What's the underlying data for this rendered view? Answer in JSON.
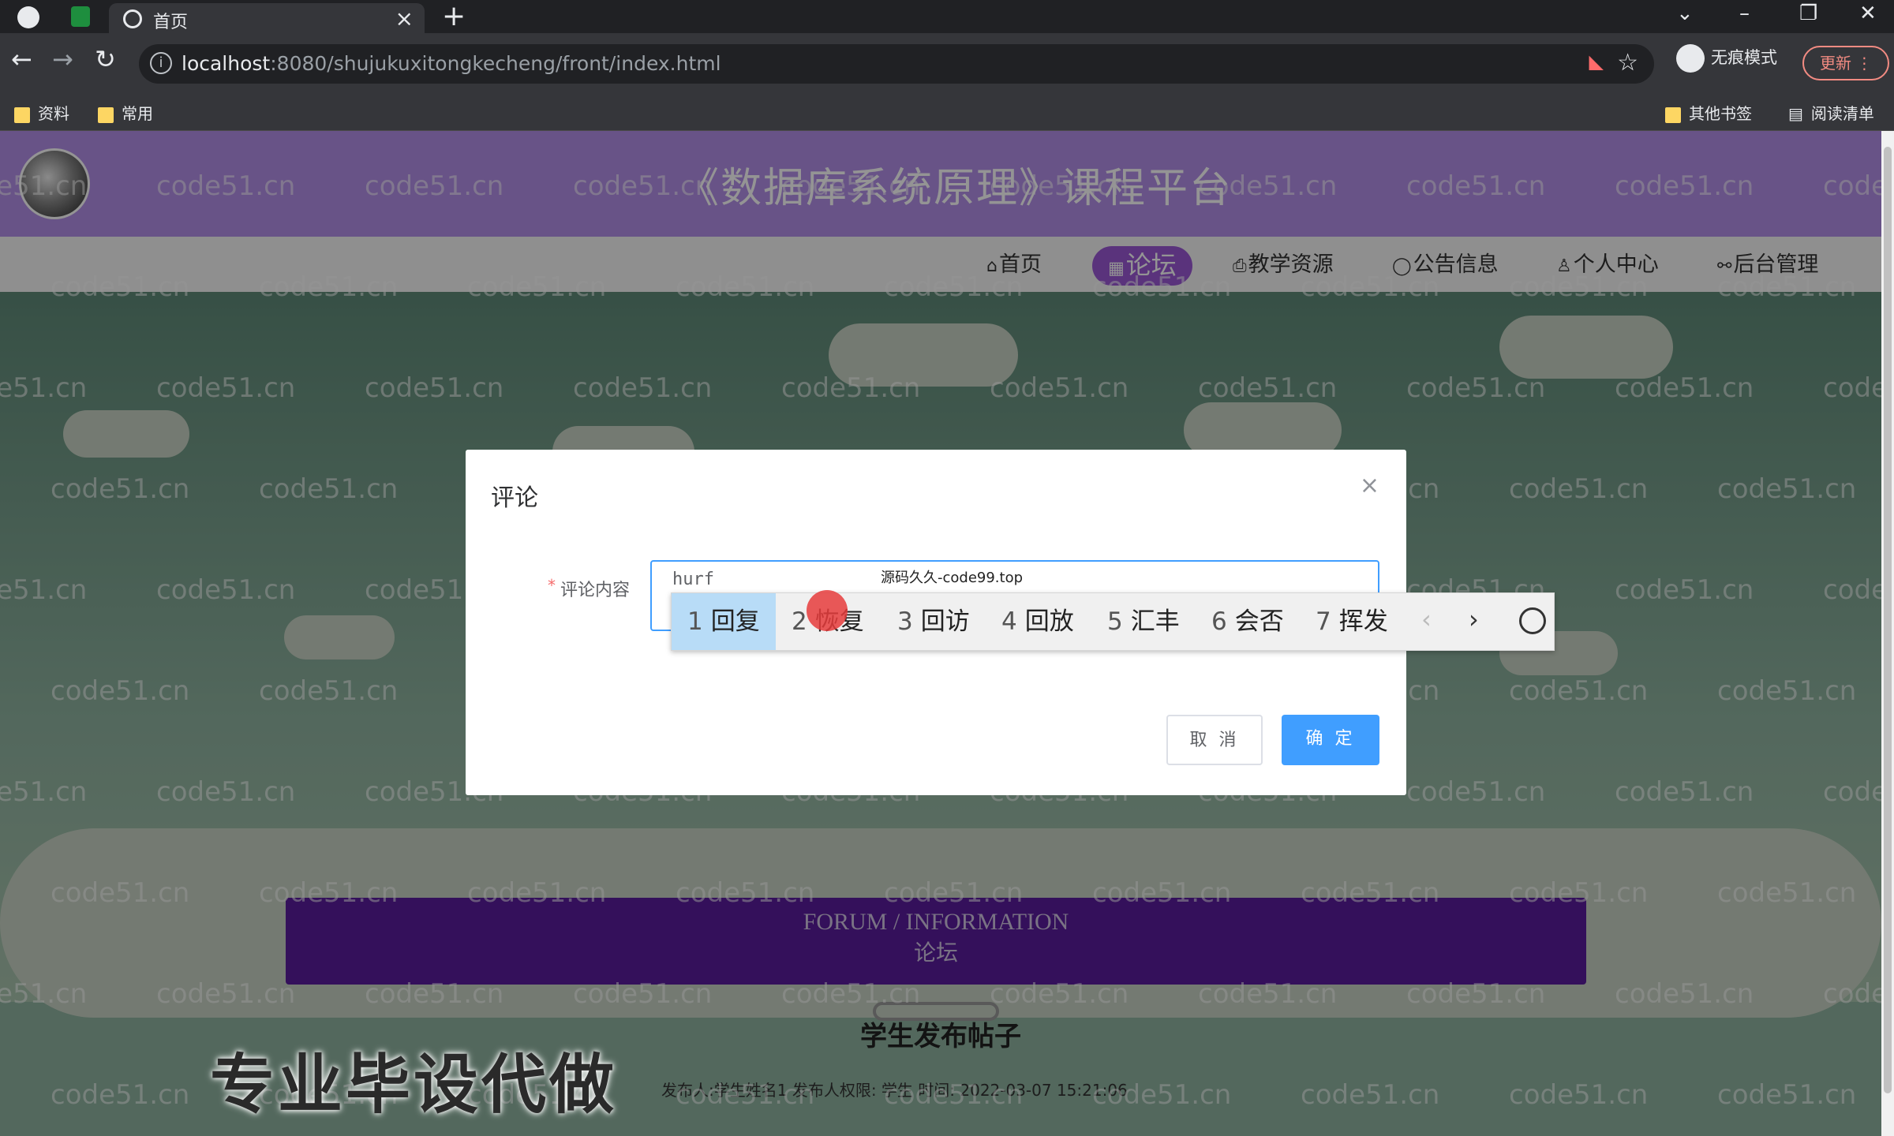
{
  "browser": {
    "tab_title": "首页",
    "tab_close": "×",
    "new_tab": "+",
    "url_host": "localhost",
    "url_rest": ":8080/shujukuxitongkecheng/front/index.html",
    "incognito_label": "无痕模式",
    "update_label": "更新",
    "nav_back": "←",
    "nav_forward": "→",
    "nav_reload": "↻",
    "bookmarks": [
      "资料",
      "常用"
    ],
    "bookmarks_right": [
      "其他书签",
      "阅读清单"
    ]
  },
  "site": {
    "title": "《数据库系统原理》课程平台",
    "nav": [
      {
        "label": "首页",
        "icon": "home-icon",
        "glyph": "⌂"
      },
      {
        "label": "论坛",
        "icon": "grid-icon",
        "glyph": "▦",
        "active": true
      },
      {
        "label": "教学资源",
        "icon": "print-icon",
        "glyph": "⎙"
      },
      {
        "label": "公告信息",
        "icon": "chat-icon",
        "glyph": "◯"
      },
      {
        "label": "个人中心",
        "icon": "user-icon",
        "glyph": "♙"
      },
      {
        "label": "后台管理",
        "icon": "link-icon",
        "glyph": "⚯"
      }
    ]
  },
  "forum_section": {
    "en": "FORUM / INFORMATION",
    "zh": "论坛"
  },
  "post": {
    "title": "学生发布帖子",
    "meta": "发布人:学生姓名1   发布人权限:  学生   时间:  2022-03-07 15:21:06"
  },
  "overlay_ad": "专业毕设代做",
  "dialog": {
    "title": "评论",
    "close": "×",
    "field_required_mark": "*",
    "field_label": "评论内容",
    "field_value": "hurf",
    "field_hint": "源码久久-code99.top",
    "cancel_label": "取 消",
    "ok_label": "确 定"
  },
  "ime": {
    "candidates": [
      {
        "n": "1",
        "text": "回复"
      },
      {
        "n": "2",
        "text": "恢复"
      },
      {
        "n": "3",
        "text": "回访"
      },
      {
        "n": "4",
        "text": "回放"
      },
      {
        "n": "5",
        "text": "汇丰"
      },
      {
        "n": "6",
        "text": "会否"
      },
      {
        "n": "7",
        "text": "挥发"
      }
    ],
    "prev": "‹",
    "next": "›"
  },
  "watermark": "code51.cn"
}
